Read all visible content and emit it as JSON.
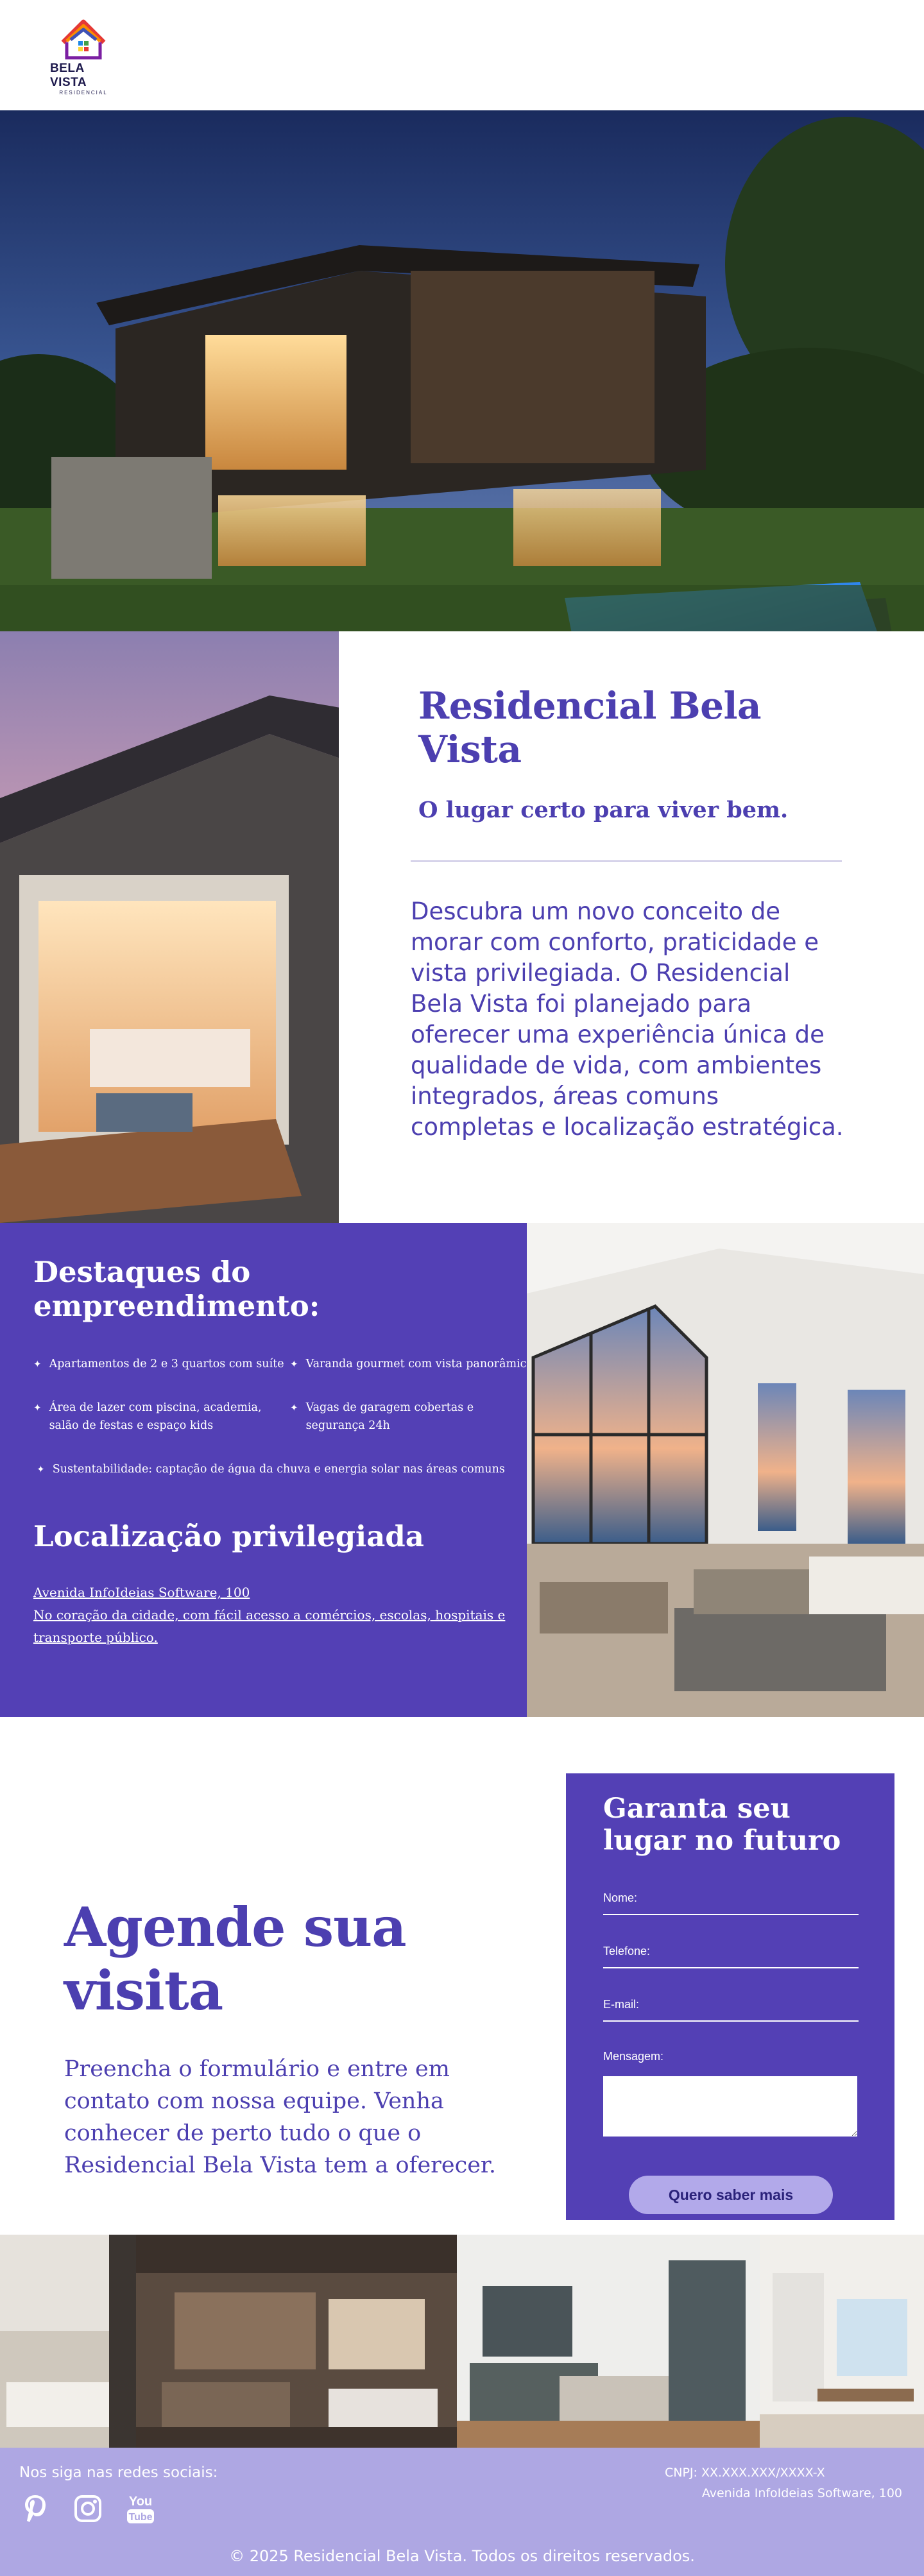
{
  "brand": {
    "logo_name": "BELA VISTA",
    "logo_sub": "RESIDENCIAL",
    "colors": {
      "primary": "#5340b5",
      "text": "#4c3fb0",
      "footer": "#aea7e3",
      "button": "#b2a9ea"
    }
  },
  "hero": {
    "image": "modern-house-night-photo"
  },
  "intro": {
    "title": "Residencial Bela Vista",
    "subtitle": "O lugar certo para viver bem.",
    "body": "Descubra um novo conceito de morar com conforto, praticidade e vista privilegiada. O Residencial Bela Vista foi planejado para oferecer uma experiência única de qualidade de vida, com ambientes integrados, áreas comuns completas e localização estratégica."
  },
  "features": {
    "title": "Destaques do empreendimento:",
    "items": [
      "Apartamentos de 2 e 3 quartos com suíte",
      "Varanda gourmet com vista panorâmica",
      "Área de lazer com piscina, academia, salão de festas e espaço kids",
      "Vagas de garagem cobertas e segurança 24h",
      "Sustentabilidade: captação de água da chuva e energia solar nas áreas comuns"
    ],
    "location_title": "Localização privilegiada",
    "location_address": "Avenida InfoIdeias Software, 100",
    "location_desc": "No coração da cidade, com fácil acesso a comércios, escolas, hospitais e transporte público."
  },
  "visit": {
    "title": "Agende sua visita",
    "body": "Preencha o formulário e entre em contato com nossa equipe. Venha conhecer de perto tudo o que o Residencial Bela Vista tem a oferecer."
  },
  "form": {
    "title": "Garanta seu lugar no futuro",
    "name_label": "Nome:",
    "phone_label": "Telefone:",
    "email_label": "E-mail:",
    "message_label": "Mensagem:",
    "submit_label": "Quero saber mais"
  },
  "footer": {
    "follow": "Nos siga nas redes sociais:",
    "socials": [
      "pinterest-icon",
      "instagram-icon",
      "youtube-icon"
    ],
    "cnpj": "CNPJ: XX.XXX.XXX/XXXX-X",
    "address": "Avenida InfoIdeias Software, 100",
    "copyright": "© 2025 Residencial Bela Vista. Todos os direitos reservados."
  }
}
